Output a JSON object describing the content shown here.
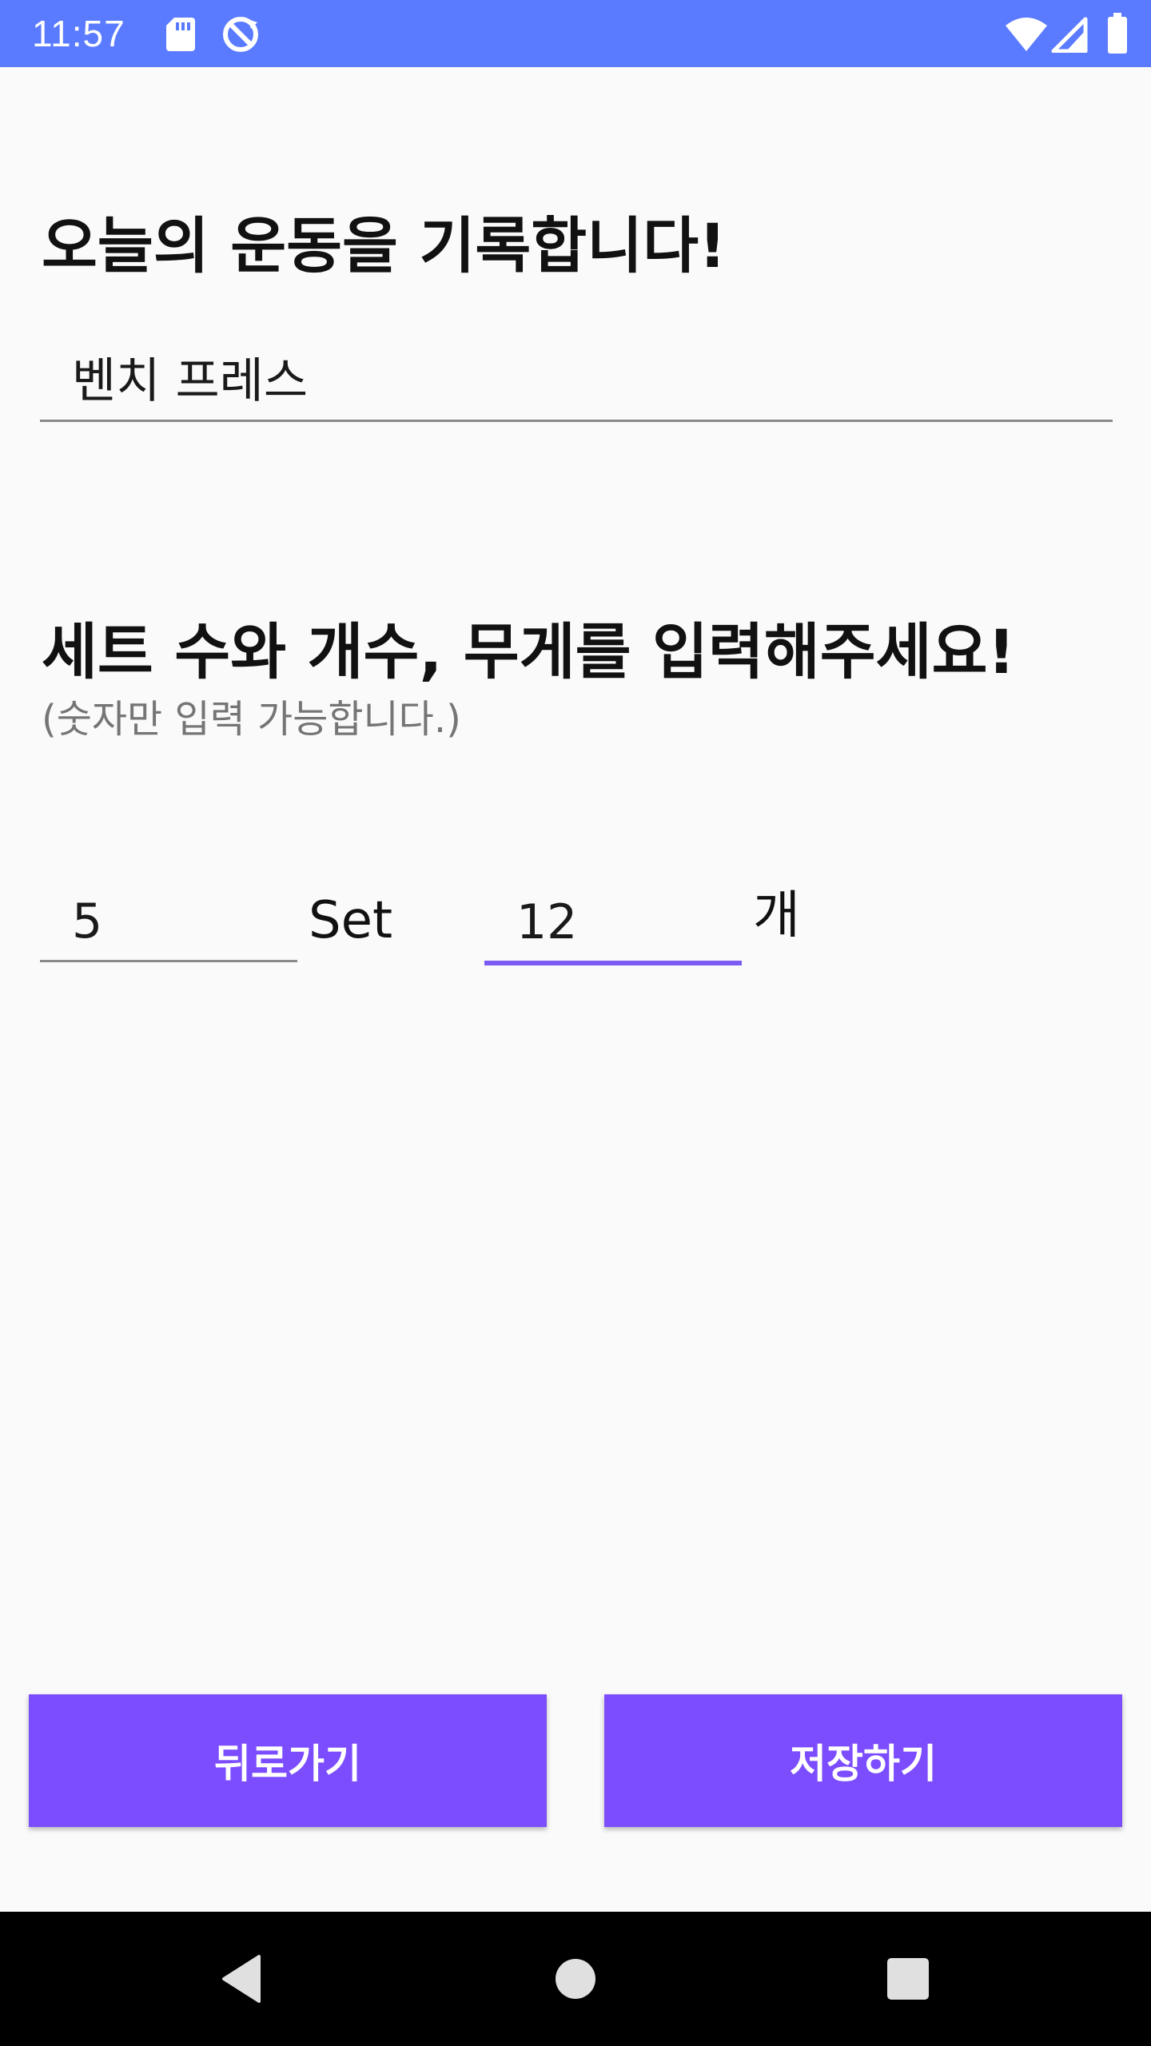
{
  "status_bar": {
    "time": "11:57",
    "background_color": "#5a7bff",
    "icons": [
      "sd-card-icon",
      "sync-disabled-icon",
      "wifi-icon",
      "signal-icon",
      "battery-icon"
    ]
  },
  "form": {
    "title": "오늘의 운동을 기록합니다!",
    "exercise_name": "벤치 프레스",
    "subtitle": "세트 수와 개수, 무게를 입력해주세요!",
    "hint": "(숫자만 입력 가능합니다.)",
    "sets_value": "5",
    "sets_unit": "Set",
    "reps_value": "12",
    "reps_unit": "개"
  },
  "buttons": {
    "back_label": "뒤로가기",
    "save_label": "저장하기",
    "color": "#7c4dff"
  },
  "focus_color": "#7a5cf2",
  "nav_bar": {
    "icons": [
      "back-triangle-icon",
      "home-circle-icon",
      "recents-square-icon"
    ]
  }
}
